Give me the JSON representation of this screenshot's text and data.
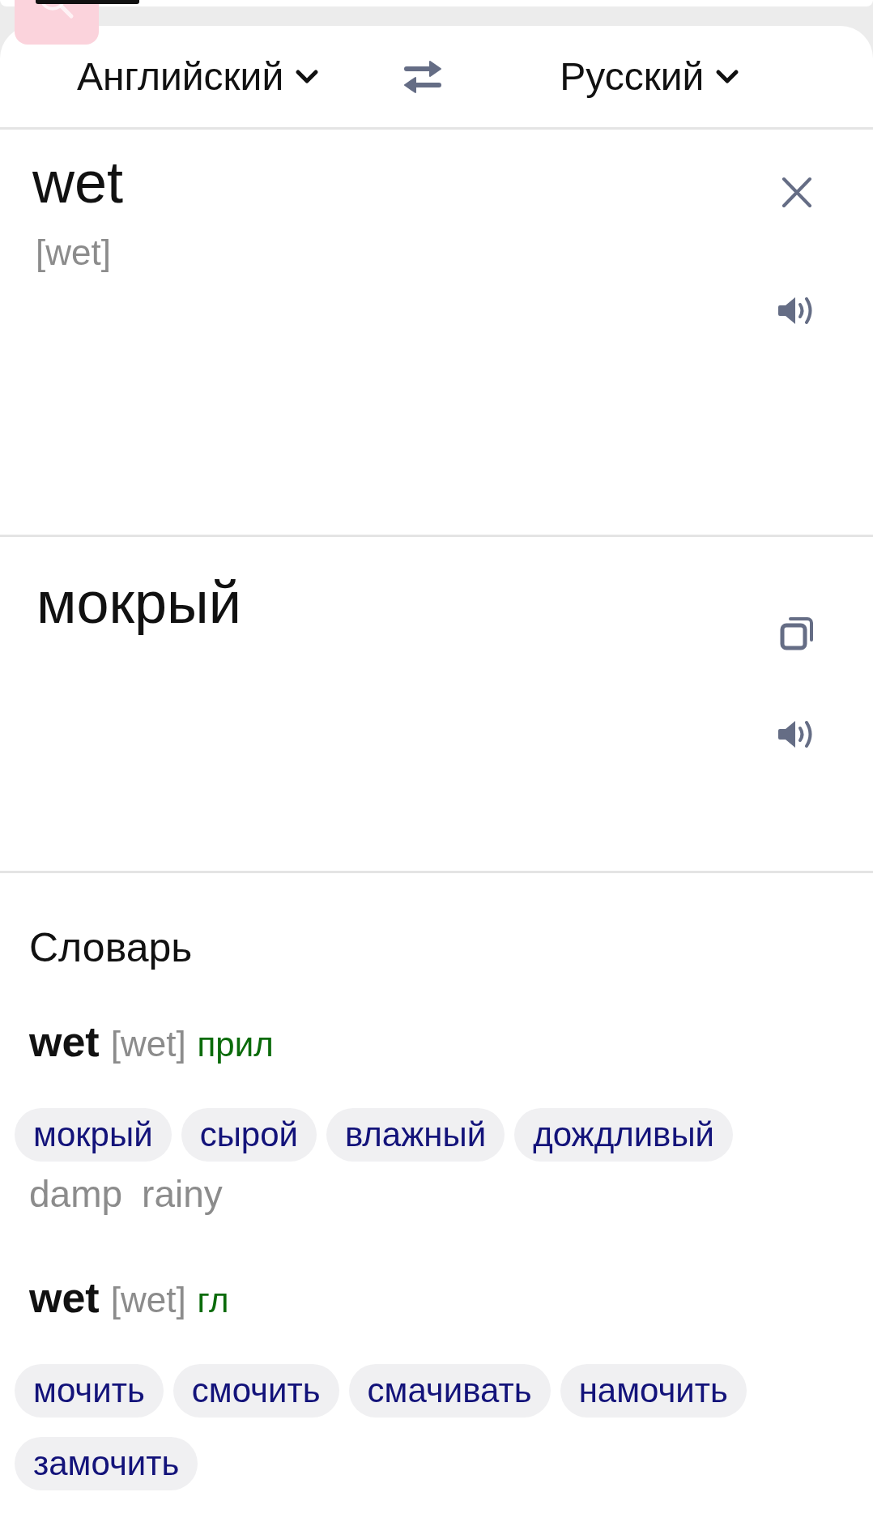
{
  "languages": {
    "source": "Английский",
    "target": "Русский"
  },
  "input": {
    "value": "wet",
    "transcription": "[wet]"
  },
  "translation": {
    "text": "мокрый"
  },
  "dictionary": {
    "title": "Словарь",
    "entries": [
      {
        "word": "wet",
        "transcription": "[wet]",
        "part_of_speech": "прил",
        "translations": [
          "мокрый",
          "сырой",
          "влажный",
          "дождливый"
        ],
        "synonyms": [
          "damp",
          "rainy"
        ]
      },
      {
        "word": "wet",
        "transcription": "[wet]",
        "part_of_speech": "гл",
        "translations": [
          "мочить",
          "смочить",
          "смачивать",
          "намочить",
          "замочить"
        ]
      }
    ]
  }
}
